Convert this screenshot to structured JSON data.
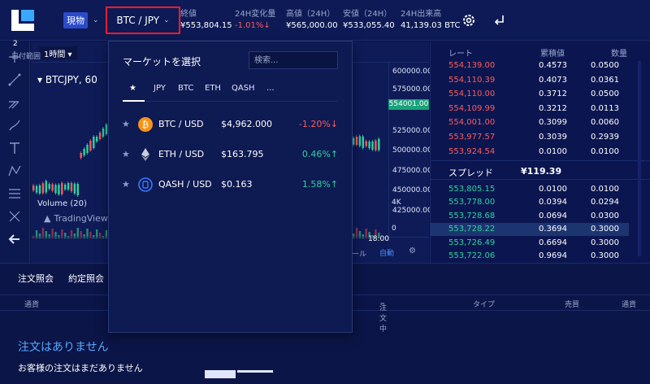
{
  "header": {
    "spot_label": "現物",
    "pair_label": "BTC / JPY",
    "stats": [
      {
        "label": "終値",
        "value": "¥553,804.15"
      },
      {
        "label": "24H変化量",
        "value": "-1.01%↓"
      },
      {
        "label": "高値（24H）",
        "value": "¥565,000.00"
      },
      {
        "label": "安値（24H）",
        "value": "¥533,055.40"
      },
      {
        "label": "24H出来高",
        "value": "41,139.03 BTC"
      }
    ]
  },
  "chart": {
    "interval": "1時間",
    "legend": "BTCJPY, 60",
    "price_ticks": [
      "600000.00",
      "575000.00",
      "525000.00",
      "500000.00",
      "475000.00",
      "450000.00",
      "425000.00"
    ],
    "last_price": "554001.00",
    "volume_label": "Volume (20)",
    "tv_label": "TradingView",
    "vol_ticks": [
      "4K",
      "0"
    ],
    "time_labels": {
      "day": "2",
      "range": "日付範囲",
      "time": "18:00",
      "scale": "ール",
      "auto": "自動"
    }
  },
  "orderbook": {
    "headers": {
      "rate": "レート",
      "cum": "累積値",
      "qty": "数量"
    },
    "asks": [
      {
        "price": "554,139.00",
        "cum": "0.4573",
        "qty": "0.0500"
      },
      {
        "price": "554,110.39",
        "cum": "0.4073",
        "qty": "0.0361"
      },
      {
        "price": "554,110.00",
        "cum": "0.3712",
        "qty": "0.0500"
      },
      {
        "price": "554,109.99",
        "cum": "0.3212",
        "qty": "0.0113"
      },
      {
        "price": "554,001.00",
        "cum": "0.3099",
        "qty": "0.0060"
      },
      {
        "price": "553,977.57",
        "cum": "0.3039",
        "qty": "0.2939"
      },
      {
        "price": "553,924.54",
        "cum": "0.0100",
        "qty": "0.0100"
      }
    ],
    "spread_label": "スプレッド",
    "spread_value": "¥119.39",
    "bids": [
      {
        "price": "553,805.15",
        "cum": "0.0100",
        "qty": "0.0100"
      },
      {
        "price": "553,778.00",
        "cum": "0.0394",
        "qty": "0.0294"
      },
      {
        "price": "553,728.68",
        "cum": "0.0694",
        "qty": "0.0300"
      },
      {
        "price": "553,728.22",
        "cum": "0.3694",
        "qty": "0.3000"
      },
      {
        "price": "553,726.49",
        "cum": "0.6694",
        "qty": "0.3000"
      },
      {
        "price": "553,722.06",
        "cum": "0.9694",
        "qty": "0.3000"
      }
    ]
  },
  "bottom": {
    "tabs": [
      "注文照会",
      "約定照会"
    ],
    "headers": [
      "通貨",
      "注文中",
      "タイプ",
      "売買",
      "通貨"
    ],
    "empty_title": "注文はありません",
    "empty_sub": "お客様の注文はまだありません"
  },
  "market_dropdown": {
    "title": "マーケットを選択",
    "search_placeholder": "検索...",
    "tabs": [
      "★",
      "JPY",
      "BTC",
      "ETH",
      "QASH",
      "..."
    ],
    "rows": [
      {
        "name": "BTC / USD",
        "price": "$4,962.000",
        "change": "-1.20%↓",
        "dir": "down",
        "icon": "bitcoin-icon"
      },
      {
        "name": "ETH / USD",
        "price": "$163.795",
        "change": "0.46%↑",
        "dir": "up",
        "icon": "ethereum-icon"
      },
      {
        "name": "QASH / USD",
        "price": "$0.163",
        "change": "1.58%↑",
        "dir": "up",
        "icon": "qash-icon"
      }
    ]
  },
  "colors": {
    "accent": "#2a4bc9",
    "highlight_box": "#ff1a2a",
    "up": "#2fd3a0",
    "down": "#ff5a5a"
  }
}
